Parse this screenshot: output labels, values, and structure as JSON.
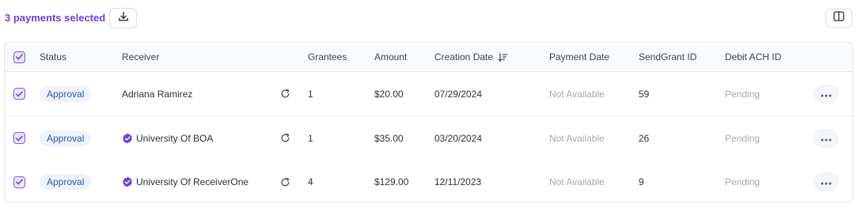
{
  "toolbar": {
    "selected_text": "3 payments selected",
    "download_icon": "download-icon",
    "columns_icon": "columns-icon"
  },
  "table": {
    "columns": [
      "Status",
      "Receiver",
      "Grantees",
      "Amount",
      "Creation Date",
      "Payment Date",
      "SendGrant ID",
      "Debit ACH ID"
    ],
    "sort_icon": "sort-descending-icon",
    "rows": [
      {
        "checked": true,
        "status": "Approval",
        "receiver": "Adriana Ramirez",
        "verified": false,
        "grantees": "1",
        "amount": "$20.00",
        "creation_date": "07/29/2024",
        "payment_date": "Not Available",
        "sendgrant_id": "59",
        "debit_ach_id": "Pending"
      },
      {
        "checked": true,
        "status": "Approval",
        "receiver": "University Of BOA",
        "verified": true,
        "grantees": "1",
        "amount": "$35.00",
        "creation_date": "03/20/2024",
        "payment_date": "Not Available",
        "sendgrant_id": "26",
        "debit_ach_id": "Pending"
      },
      {
        "checked": true,
        "status": "Approval",
        "receiver": "University Of ReceiverOne",
        "verified": true,
        "grantees": "4",
        "amount": "$129.00",
        "creation_date": "12/11/2023",
        "payment_date": "Not Available",
        "sendgrant_id": "9",
        "debit_ach_id": "Pending"
      }
    ]
  },
  "colors": {
    "accent": "#6d3fe0",
    "badge_bg": "#eef2fb",
    "badge_text": "#2d5aa8",
    "muted_text": "#a3a9b5"
  }
}
